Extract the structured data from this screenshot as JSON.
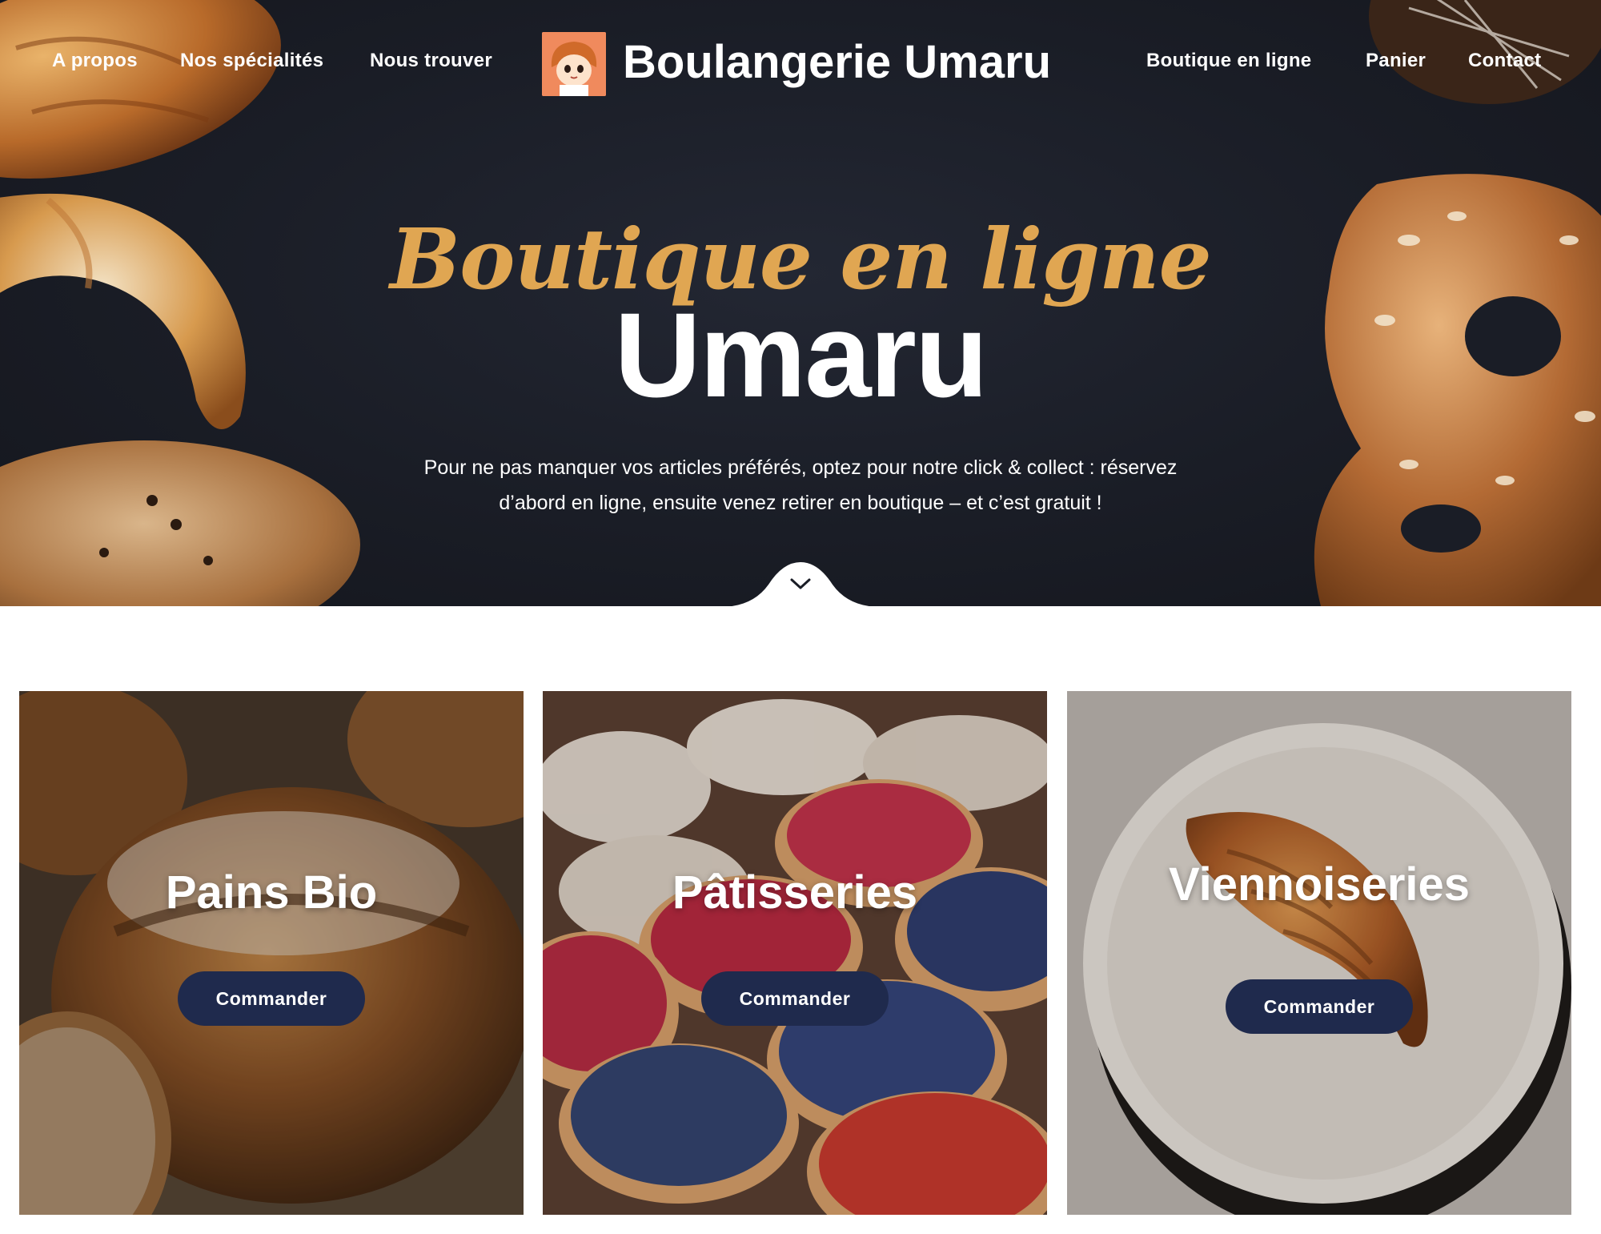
{
  "nav": {
    "left": [
      "A propos",
      "Nos spécialités",
      "Nous trouver"
    ],
    "right": [
      "Boutique en ligne",
      "Panier",
      "Contact"
    ],
    "brand": "Boulangerie Umaru"
  },
  "hero": {
    "script_title": "Boutique en ligne",
    "title": "Umaru",
    "text_line1": "Pour ne pas manquer vos articles préférés, optez pour notre click & collect : réservez",
    "text_line2": "d’abord en ligne, ensuite venez retirer en boutique – et c’est gratuit !"
  },
  "cards": [
    {
      "title": "Pains Bio",
      "button": "Commander"
    },
    {
      "title": "Pâtisseries",
      "button": "Commander"
    },
    {
      "title": "Viennoiseries",
      "button": "Commander"
    }
  ],
  "colors": {
    "hero_bg": "#1a1d26",
    "accent_gold": "#e0a652",
    "button_navy": "#1f2a4d"
  },
  "icons": {
    "logo": "umaru-logo-icon",
    "scroll": "chevron-down-icon"
  }
}
